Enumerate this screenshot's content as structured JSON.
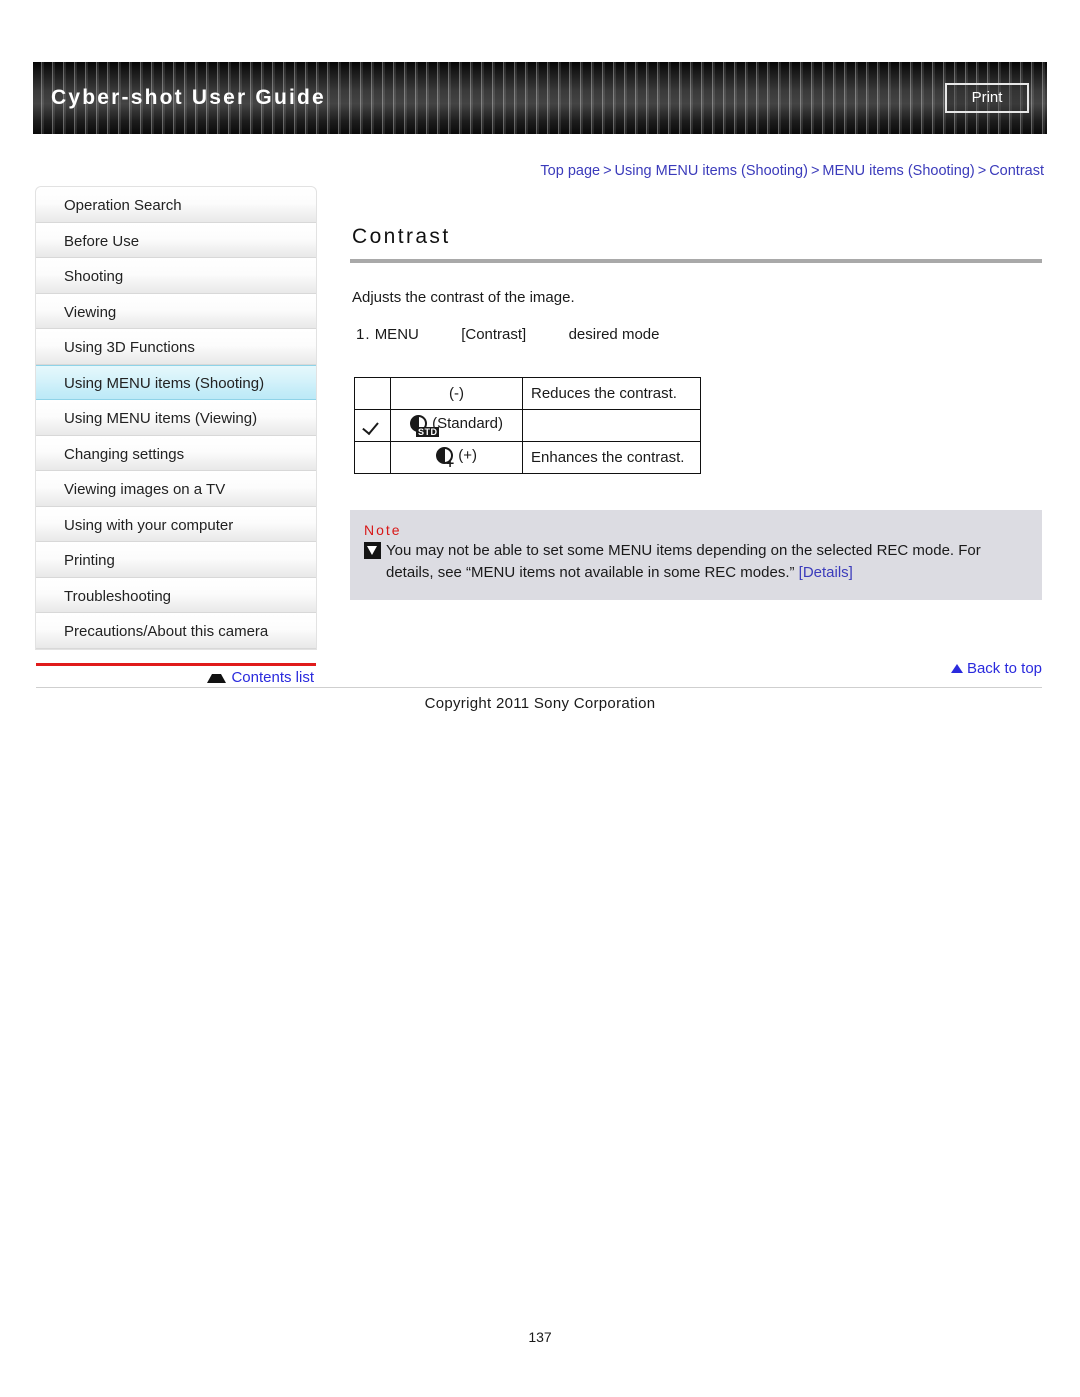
{
  "header": {
    "title": "Cyber-shot User Guide",
    "print_label": "Print"
  },
  "breadcrumb": {
    "items": [
      "Top page",
      "Using MENU items (Shooting)",
      "MENU items (Shooting)",
      "Contrast"
    ],
    "separator": ">"
  },
  "sidebar": {
    "items": [
      {
        "label": "Operation Search",
        "active": false
      },
      {
        "label": "Before Use",
        "active": false
      },
      {
        "label": "Shooting",
        "active": false
      },
      {
        "label": "Viewing",
        "active": false
      },
      {
        "label": "Using 3D Functions",
        "active": false
      },
      {
        "label": "Using MENU items (Shooting)",
        "active": true
      },
      {
        "label": "Using MENU items (Viewing)",
        "active": false
      },
      {
        "label": "Changing settings",
        "active": false
      },
      {
        "label": "Viewing images on a TV",
        "active": false
      },
      {
        "label": "Using with your computer",
        "active": false
      },
      {
        "label": "Printing",
        "active": false
      },
      {
        "label": "Troubleshooting",
        "active": false
      },
      {
        "label": "Precautions/About this camera",
        "active": false
      }
    ],
    "contents_list_label": "Contents list",
    "accent_rule_color": "#e01b1b"
  },
  "main": {
    "title": "Contrast",
    "lead": "Adjusts the contrast of the image.",
    "step": {
      "number": "1.",
      "part1": "MENU",
      "part2": "[Contrast]",
      "part3": "desired mode"
    },
    "options_table": {
      "rows": [
        {
          "checked": "",
          "mode": "(-)",
          "desc": "Reduces the contrast."
        },
        {
          "checked": "✓",
          "mode": "(Standard)",
          "desc": ""
        },
        {
          "checked": "",
          "mode": "(+)",
          "desc": "Enhances the contrast."
        }
      ]
    },
    "note": {
      "label": "Note",
      "text": "You may not be able to set some MENU items depending on the selected REC mode. For details, see “MENU items not available in some REC modes.” ",
      "link": "[Details]"
    },
    "back_to_top": "Back to top"
  },
  "footer": {
    "copyright": "Copyright 2011 Sony Corporation",
    "page_number": "137"
  },
  "colors": {
    "link": "#3b3bbb",
    "note_bg": "#dcdce2",
    "note_label": "#d81717",
    "highlight": "#c3ecf8"
  }
}
